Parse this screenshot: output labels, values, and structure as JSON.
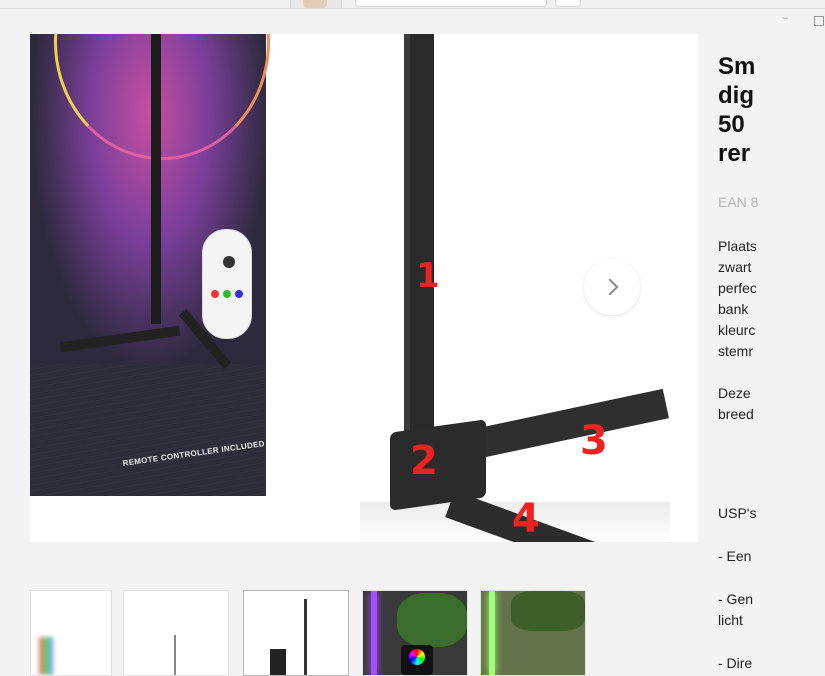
{
  "window": {
    "minimize_glyph": "–"
  },
  "gallery": {
    "box_caption": "REMOTE CONTROLLER INCLUDED",
    "annotations": [
      "1",
      "2",
      "3",
      "4"
    ],
    "next_icon": "chevron-right-icon",
    "thumbnails_count": 5
  },
  "product": {
    "title_lines": [
      "Sm",
      "dig",
      "50",
      "rer"
    ],
    "ean": "EAN 8",
    "description_lines_1": [
      "Plaats",
      "zwart",
      "perfec",
      "bank",
      "kleurc",
      "stemr"
    ],
    "description_lines_2": [
      "Deze",
      "breed"
    ],
    "usps_heading": "USP's",
    "usps": [
      "- Een",
      "- Gen",
      "licht",
      "- Dire"
    ]
  },
  "colors": {
    "annotation_red": "#e22222",
    "page_bg": "#f3f3f3"
  }
}
